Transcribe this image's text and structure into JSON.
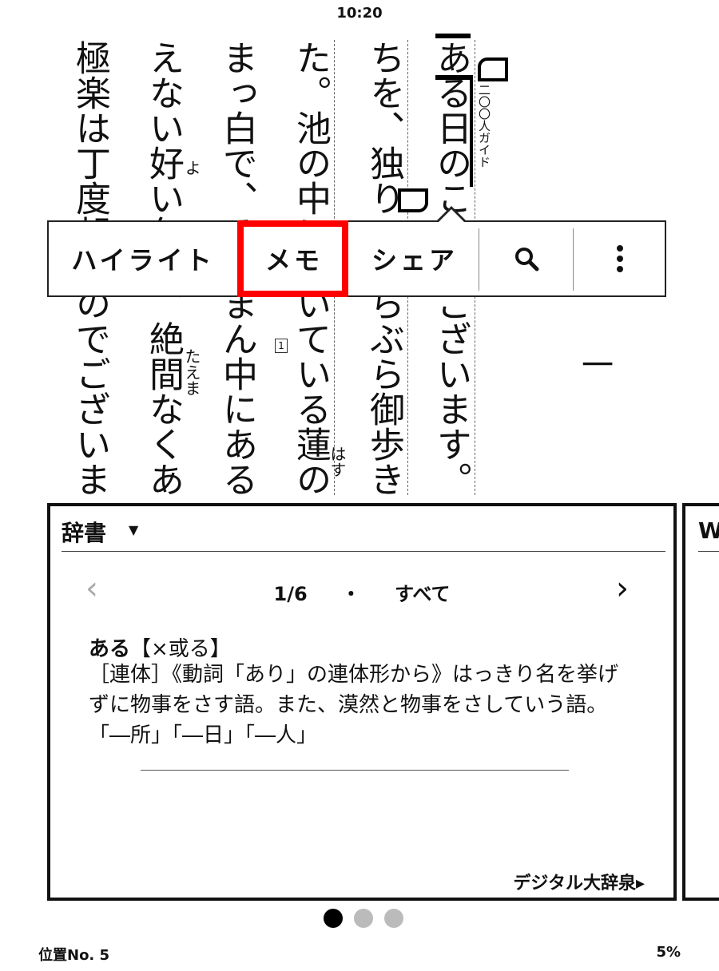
{
  "status_bar": {
    "time": "10:20"
  },
  "reader": {
    "columns": [
      "極楽は丁度朝なのでございます",
      "えない好い匂が、絶間なくあ",
      "まっ白で、そのまん中にある",
      "た。池の中に咲いている蓮の",
      "ちを、独りでぶらぶら御歩き",
      "ある日のことでございます。"
    ],
    "ruby": {
      "yo": "よ",
      "taema": "たえま",
      "hasu": "はす"
    },
    "chapter_number": "一",
    "title_small": "二〇〇人ガイド",
    "footnote_marker": "1"
  },
  "context_menu": {
    "highlight": "ハイライト",
    "memo": "メモ",
    "share": "シェア",
    "search_icon": "search-icon",
    "more_icon": "more-vertical-icon"
  },
  "dictionary": {
    "title": "辞書",
    "pager": {
      "position": "1/6",
      "separator": "・",
      "scope": "すべて"
    },
    "entry": {
      "headword": "ある",
      "kanji": "【×或る】",
      "definition": "［連体］《動詞「あり」の連体形から》はっきり名を挙げずに物事をさす語。また、漠然と物事をさしていう語。「―所」「―日」「―人」"
    },
    "source": "デジタル大辞泉▸",
    "next_panel_letter": "W"
  },
  "pagination": {
    "total": 3,
    "active": 0
  },
  "footer": {
    "location": "位置No. 5",
    "progress": "5%"
  }
}
